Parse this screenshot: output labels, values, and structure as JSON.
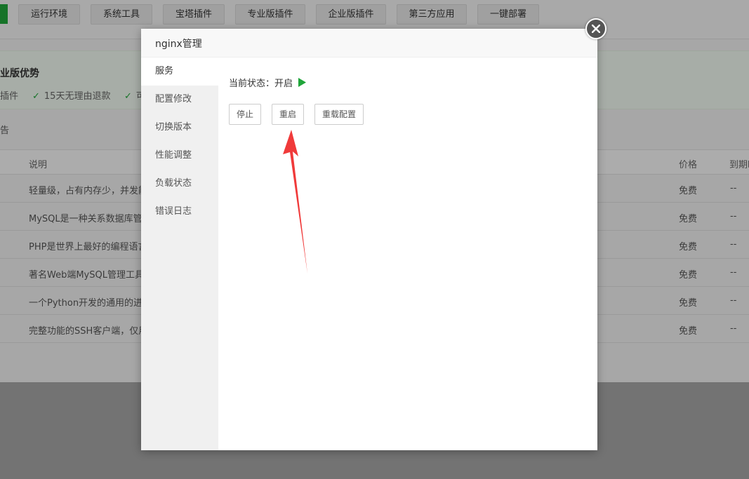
{
  "colors": {
    "accent": "#20a53a",
    "arrow": "#f03a3a"
  },
  "nav": {
    "tabs": [
      "运行环境",
      "系统工具",
      "宝塔插件",
      "专业版插件",
      "企业版插件",
      "第三方应用",
      "一键部署"
    ]
  },
  "promo": {
    "title": "业版优势",
    "items": [
      "插件",
      "15天无理由退款",
      "可"
    ]
  },
  "search_label": "告",
  "table": {
    "headers": {
      "desc": "说明",
      "price": "价格",
      "expire": "到期时"
    },
    "rows": [
      {
        "desc": "轻量级，占有内存少，并发能力",
        "price": "免费",
        "expire": "--"
      },
      {
        "desc": "MySQL是一种关系数据库管理",
        "price": "免费",
        "expire": "--"
      },
      {
        "desc": "PHP是世界上最好的编程语言",
        "price": "免费",
        "expire": "--"
      },
      {
        "desc": "著名Web端MySQL管理工具",
        "price": "免费",
        "expire": "--"
      },
      {
        "desc": "一个Python开发的通用的进程",
        "price": "免费",
        "expire": "--"
      },
      {
        "desc": "完整功能的SSH客户端，仅用于",
        "price": "免费",
        "expire": "--"
      }
    ]
  },
  "modal": {
    "title": "nginx管理",
    "close_icon": "close-icon",
    "sidebar": [
      "服务",
      "配置修改",
      "切换版本",
      "性能调整",
      "负载状态",
      "错误日志"
    ],
    "active_index": 0,
    "status_label": "当前状态：",
    "status_value": "开启",
    "status_icon": "play-icon",
    "buttons": {
      "stop": "停止",
      "restart": "重启",
      "reload": "重载配置"
    }
  }
}
